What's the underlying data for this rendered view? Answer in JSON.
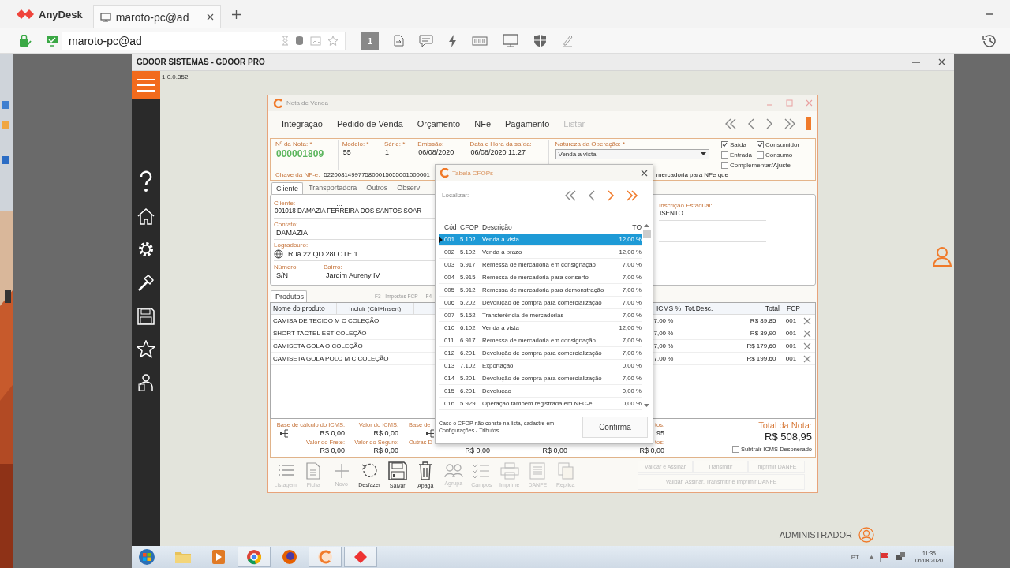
{
  "anydesk": {
    "app_name": "AnyDesk",
    "tab_label": "maroto-pc@ad",
    "address": "maroto-pc@ad",
    "display": "1"
  },
  "remote": {
    "title": "GDOOR SISTEMAS - GDOOR PRO",
    "version": "1.0.0.352",
    "user": "ADMINISTRADOR"
  },
  "sale": {
    "title": "Nota de Venda",
    "menu": [
      {
        "label": "Integração",
        "disabled": false
      },
      {
        "label": "Pedido de Venda",
        "disabled": false
      },
      {
        "label": "Orçamento",
        "disabled": false
      },
      {
        "label": "NFe",
        "disabled": false
      },
      {
        "label": "Pagamento",
        "disabled": false
      },
      {
        "label": "Listar",
        "disabled": true
      }
    ],
    "fields": [
      {
        "label": "Nº da Nota: *",
        "value": "000001809",
        "kind": "number"
      },
      {
        "label": "Modelo: *",
        "value": "55",
        "kind": "text"
      },
      {
        "label": "Série: *",
        "value": "1",
        "kind": "text"
      },
      {
        "label": "Emissão:",
        "value": "06/08/2020",
        "kind": "text"
      },
      {
        "label": "Data e Hora da saída:",
        "value": "06/08/2020  11:27",
        "kind": "text"
      }
    ],
    "nature": {
      "label": "Natureza da Operação: *",
      "value": "Venda a vista"
    },
    "options": [
      {
        "label": "Saída",
        "checked": true
      },
      {
        "label": "Consumidor",
        "checked": true
      },
      {
        "label": "Entrada",
        "checked": false
      },
      {
        "label": "Consumo",
        "checked": false
      },
      {
        "label": "Complementar/Ajuste",
        "checked": false
      }
    ],
    "access_key": {
      "label": "Chave da NF-e:",
      "value": "5220081499775800015055001000001"
    },
    "hint_tail": "mercadoria para NFe que",
    "tabs": [
      {
        "label": "Cliente",
        "selected": true
      },
      {
        "label": "Transportadora",
        "selected": false
      },
      {
        "label": "Outros",
        "selected": false
      },
      {
        "label": "Observ",
        "selected": false
      }
    ],
    "client": {
      "client_label": "Cliente:",
      "lookup": "...",
      "client_value": "001018 DAMAZIA FERREIRA DOS SANTOS SOAR",
      "contact_label": "Contato:",
      "contact_value": "DAMAZIA",
      "street_label": "Logradouro:",
      "street_value": "Rua 22 QD 28LOTE 1",
      "number_label": "Número:",
      "number_value": "S/N",
      "district_label": "Bairro:",
      "district_value": "Jardim Aureny IV",
      "state_reg_label": "Inscrição Estadual:",
      "state_reg_value": "ISENTO"
    },
    "products": {
      "tab": "Produtos",
      "shortcuts": [
        "F3 - Impostos FCP",
        "F4"
      ],
      "name_column": "Nome do produto",
      "add_button": "Incluir (Ctrl+Insert)",
      "columns": [
        "ICMS %",
        "Tot.Desc.",
        "Total",
        "FCP"
      ],
      "rows": [
        {
          "name": "CAMISA DE TECIDO M C COLEÇÃO",
          "icms": "7,00 %",
          "total": "R$ 89,85",
          "fcp": "001"
        },
        {
          "name": "SHORT TACTEL EST COLEÇÃO",
          "icms": "7,00 %",
          "total": "R$ 39,90",
          "fcp": "001"
        },
        {
          "name": "CAMISETA GOLA O COLEÇÃO",
          "icms": "7,00 %",
          "total": "R$ 179,60",
          "fcp": "001"
        },
        {
          "name": "CAMISETA GOLA POLO M C COLEÇÃO",
          "icms": "7,00 %",
          "total": "R$ 199,60",
          "fcp": "001"
        }
      ]
    },
    "totals": [
      {
        "label_1": "Base de cálculo do ICMS:",
        "value_1": "R$ 0,00",
        "label_2": "Valor do Frete:",
        "value_2": "R$ 0,00",
        "detail_icon": true
      },
      {
        "label_1": "Valor do ICMS:",
        "value_1": "R$ 0,00",
        "label_2": "Valor do Seguro:",
        "value_2": "R$ 0,00",
        "detail_icon": false
      },
      {
        "label_1": "Base de",
        "label_2": "Outras D",
        "detail_icon": true
      },
      {
        "value_2": "R$ 0,00",
        "detail_icon": false
      },
      {
        "value_2": "R$ 0,00",
        "detail_icon": false
      },
      {
        "label_1": "tos:",
        "value_1": "95",
        "label_2": "tos:",
        "value_2": "R$ 0,00",
        "detail_icon": false
      }
    ],
    "grand_total": {
      "label": "Total da Nota:",
      "value": "R$ 508,95"
    },
    "subtract_icms": {
      "label": "Subtrair ICMS Desonerado",
      "checked": false
    },
    "toolbar": [
      {
        "label": "Listagem",
        "kind": "list",
        "disabled": true
      },
      {
        "label": "Ficha",
        "kind": "page",
        "disabled": true
      },
      {
        "label": "Novo",
        "kind": "plus",
        "disabled": true
      },
      {
        "label": "Desfazer",
        "kind": "undo",
        "disabled": false
      },
      {
        "label": "Salvar",
        "kind": "floppy",
        "disabled": false
      },
      {
        "label": "Apaga",
        "kind": "trash",
        "disabled": false
      },
      {
        "label": "Agrupa",
        "kind": "people",
        "disabled": true
      },
      {
        "label": "Campos",
        "kind": "checklist",
        "disabled": true
      },
      {
        "label": "Imprime",
        "kind": "printer",
        "disabled": true
      },
      {
        "label": "DANFE",
        "kind": "document",
        "disabled": true
      },
      {
        "label": "Replica",
        "kind": "copy",
        "disabled": true
      }
    ],
    "actions": [
      {
        "label": "Validar e Assinar",
        "disabled": true
      },
      {
        "label": "Transmitir",
        "disabled": true
      },
      {
        "label": "Imprimir DANFE",
        "disabled": true
      },
      {
        "label": "Validar, Assinar, Transmitir e Imprimir DANFE",
        "disabled": true
      }
    ]
  },
  "cfop": {
    "title": "Tabela CFOPs",
    "search_label": "Localizar:",
    "columns": [
      "Cód",
      "CFOP",
      "Descrição",
      "TO"
    ],
    "rows": [
      {
        "code": "001",
        "cfop": "5.102",
        "description": "Venda a vista",
        "rate": "12,00 %",
        "selected": true
      },
      {
        "code": "002",
        "cfop": "5.102",
        "description": "Venda a prazo",
        "rate": "12,00 %",
        "selected": false
      },
      {
        "code": "003",
        "cfop": "5.917",
        "description": "Remessa de mercadoria em consignação",
        "rate": "7,00 %",
        "selected": false
      },
      {
        "code": "004",
        "cfop": "5.915",
        "description": "Remessa de mercadoria para conserto",
        "rate": "7,00 %",
        "selected": false
      },
      {
        "code": "005",
        "cfop": "5.912",
        "description": "Remessa de mercadoria para demonstração",
        "rate": "7,00 %",
        "selected": false
      },
      {
        "code": "006",
        "cfop": "5.202",
        "description": "Devolução de compra para comercialização",
        "rate": "7,00 %",
        "selected": false
      },
      {
        "code": "007",
        "cfop": "5.152",
        "description": "Transferência de mercadorias",
        "rate": "7,00 %",
        "selected": false
      },
      {
        "code": "010",
        "cfop": "6.102",
        "description": "Venda a vista",
        "rate": "12,00 %",
        "selected": false
      },
      {
        "code": "011",
        "cfop": "6.917",
        "description": "Remessa de mercadoria em consignação",
        "rate": "7,00 %",
        "selected": false
      },
      {
        "code": "012",
        "cfop": "6.201",
        "description": "Devolução de compra para comercialização",
        "rate": "7,00 %",
        "selected": false
      },
      {
        "code": "013",
        "cfop": "7.102",
        "description": "Exportação",
        "rate": "0,00 %",
        "selected": false
      },
      {
        "code": "014",
        "cfop": "5.201",
        "description": "Devolução de compra para comercialização",
        "rate": "7,00 %",
        "selected": false
      },
      {
        "code": "015",
        "cfop": "6.201",
        "description": "Devoluçao",
        "rate": "0,00 %",
        "selected": false
      },
      {
        "code": "016",
        "cfop": "5.929",
        "description": "Operação também registrada em NFC-e",
        "rate": "0,00 %",
        "selected": false
      }
    ],
    "note": "Caso o CFOP não conste na lista, cadastre em Configurações - Tributos",
    "confirm": "Confirma"
  },
  "taskbar": {
    "apps": [
      {
        "kind": "folder",
        "running": false
      },
      {
        "kind": "media",
        "running": false
      },
      {
        "kind": "browser",
        "running": true
      },
      {
        "kind": "fox",
        "running": false
      },
      {
        "kind": "gdoor",
        "running": true
      },
      {
        "kind": "anydesk",
        "running": true
      }
    ],
    "language": "PT",
    "time": "11:35",
    "date": "06/08/2020"
  }
}
